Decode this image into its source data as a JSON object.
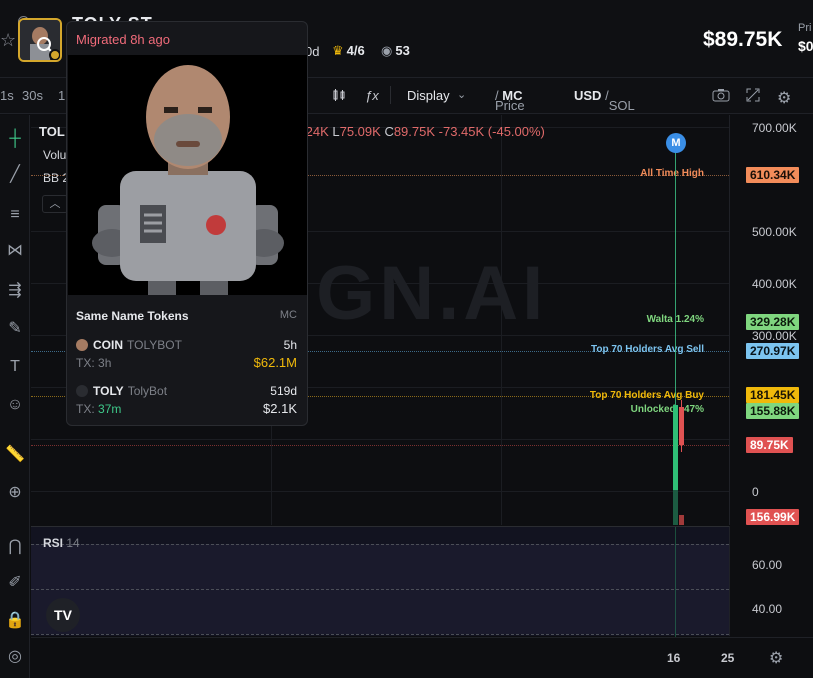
{
  "header": {
    "token_name": "TOLY ST",
    "age": "0d",
    "crown_count": "4/6",
    "viewers": "53",
    "price": "$89.75K",
    "price_col_label": "Pri",
    "price_col_value": "$0"
  },
  "toolbar": {
    "timeframes": [
      "1s",
      "30s",
      "1"
    ],
    "candle_icon": "candlestick-icon",
    "fx": "ƒx",
    "display": "Display",
    "price_label": "Price",
    "mc_label": "MC",
    "usd_label": "USD",
    "sol_label": "SOL"
  },
  "legend": {
    "symbol": "TOL",
    "ohlc_h": "4.24K",
    "l_key": "L",
    "l_val": "75.09K",
    "c_key": "C",
    "c_val": "89.75K",
    "change": "-73.45K (-45.00%)",
    "volume": "Volu",
    "bb": "BB 2"
  },
  "watermark": "IGN.AI",
  "markers": {
    "m_badge": "M",
    "all_time_high": "All Time High",
    "walta": "Walta 1.24%",
    "top70_sell": "Top 70 Holders Avg Sell",
    "top70_buy": "Top 70 Holders Avg Buy",
    "unlocked": "Unlocked...47%"
  },
  "yaxis": {
    "ticks": [
      "700.00K",
      "500.00K",
      "400.00K",
      "300.00K",
      "0"
    ],
    "badges": {
      "ath": "610.34K",
      "walta": "329.28K",
      "sell": "270.97K",
      "buy": "181.45K",
      "unlocked": "155.88K",
      "price": "89.75K",
      "volume": "156.99K"
    }
  },
  "rsi": {
    "label": "RSI",
    "period": "14",
    "ticks": [
      "60.00",
      "40.00"
    ],
    "tv_logo": "TV"
  },
  "xaxis": {
    "ticks": [
      "16",
      "25"
    ]
  },
  "popover": {
    "status": "Migrated 8h ago",
    "section_title": "Same Name Tokens",
    "mc_header": "MC",
    "tokens": [
      {
        "symbol": "COIN",
        "name": "TOLYBOT",
        "age": "5h",
        "tx_label": "TX:",
        "tx": "3h",
        "mc": "$62.1M",
        "mc_color": "#f0b90b",
        "tx_color": "#7d8088"
      },
      {
        "symbol": "TOLY",
        "name": "TolyBot",
        "age": "519d",
        "tx_label": "TX:",
        "tx": "37m",
        "mc": "$2.1K",
        "mc_color": "#e6e8ec",
        "tx_color": "#3ec98a"
      }
    ]
  },
  "colors": {
    "accent_red": "#f06b7a",
    "up": "#2fbf76",
    "down": "#e05252",
    "ath": "#f28c5a",
    "walta": "#7fd67f",
    "sell": "#7cc4f0",
    "buy": "#f0b90b"
  }
}
